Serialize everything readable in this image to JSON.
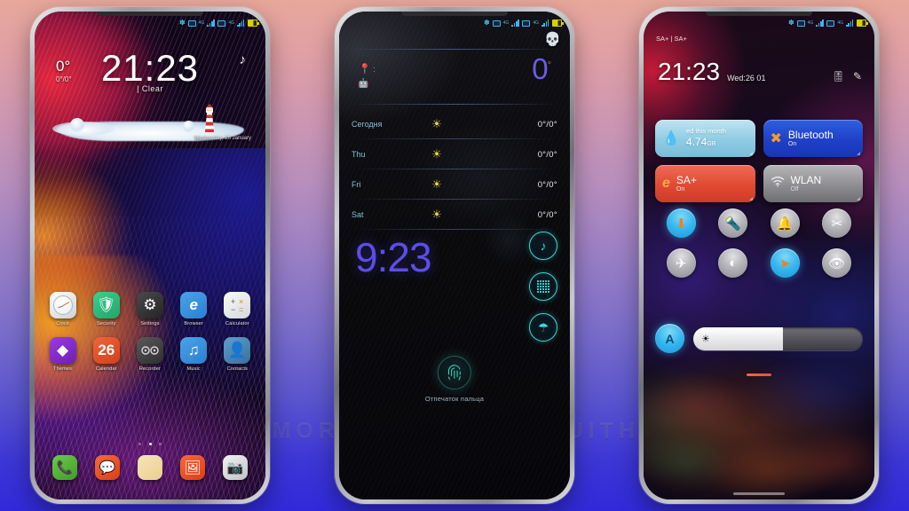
{
  "watermark": {
    "text": "VISIT FOR MORE THEMES - MIUITHEMER.COM"
  },
  "background": {
    "top_color": "#e8a79b",
    "mid_color": "#9a7fc4",
    "bottom_color": "#3129d9"
  },
  "phone1": {
    "name": "Lock screen / Home screen",
    "statusbar": {
      "bluetooth": "bluetooth-icon",
      "sim1": "sim-icon",
      "net1": "4G",
      "sim2": "sim-icon",
      "net2": "4G",
      "battery": "battery-icon"
    },
    "weather_corner": {
      "temp": "0°",
      "range": "0°/0°"
    },
    "clock": "21:23",
    "condition": "| Clear",
    "music_icon": "music-note-icon",
    "date": "Wednesday, 26 January",
    "apps_row1": [
      {
        "label": "Clock",
        "icon": "clock-icon"
      },
      {
        "label": "Security",
        "icon": "shield-icon"
      },
      {
        "label": "Settings",
        "icon": "gear-icon"
      },
      {
        "label": "Browser",
        "icon": "browser-e-icon"
      },
      {
        "label": "Calculator",
        "icon": "calculator-icon"
      }
    ],
    "apps_row2": [
      {
        "label": "Themes",
        "icon": "themes-diamond-icon"
      },
      {
        "label": "Calendar",
        "icon": "26"
      },
      {
        "label": "Recorder",
        "icon": "recorder-icon"
      },
      {
        "label": "Music",
        "icon": "music-icon"
      },
      {
        "label": "Contacts",
        "icon": "contacts-icon"
      }
    ],
    "dock": [
      {
        "label": "Phone",
        "icon": "phone-icon"
      },
      {
        "label": "Messages",
        "icon": "message-icon"
      },
      {
        "label": "Notes",
        "icon": "notes-icon"
      },
      {
        "label": "Gallery",
        "icon": "gallery-icon"
      },
      {
        "label": "Camera",
        "icon": "camera-icon"
      }
    ],
    "page_dots": 3,
    "active_dot": 1
  },
  "phone2": {
    "name": "Weather lock screen",
    "skull_icon": "skull-icon",
    "location_label": ":",
    "location_pin": "location-pin-icon",
    "android_icon": "android-icon",
    "big_temp": "0",
    "big_temp_unit": "°",
    "forecast": [
      {
        "day": "Сегодня",
        "icon": "sun-icon",
        "temps": "0°/0°"
      },
      {
        "day": "Thu",
        "icon": "sun-icon",
        "temps": "0°/0°"
      },
      {
        "day": "Fri",
        "icon": "sun-icon",
        "temps": "0°/0°"
      },
      {
        "day": "Sat",
        "icon": "sun-icon",
        "temps": "0°/0°"
      }
    ],
    "clock": "9:23",
    "side_buttons": [
      {
        "icon": "music-note-icon",
        "name": "music"
      },
      {
        "icon": "app-grid-icon",
        "name": "apps"
      },
      {
        "icon": "umbrella-icon",
        "name": "weather"
      }
    ],
    "fingerprint_icon": "fingerprint-icon",
    "fingerprint_label": "Отпечаток пальца"
  },
  "phone3": {
    "name": "Notification shade / Quick settings",
    "carrier": "SA+ | SA+",
    "clock": "21:23",
    "date": "Wed:26 01",
    "header_icons": [
      {
        "icon": "settings-slider-icon"
      },
      {
        "icon": "edit-pencil-icon"
      }
    ],
    "tiles": [
      {
        "title": "ed this month",
        "value": "4.74",
        "unit": "GB",
        "icon": "data-drop-icon",
        "state": "",
        "color": "#8fcbe4"
      },
      {
        "title": "Bluetooth",
        "sub": "On",
        "icon": "bluetooth-icon",
        "color": "#1e40c8"
      },
      {
        "title": "SA+",
        "sub": "On",
        "icon": "browser-e-icon",
        "color": "#e04a33"
      },
      {
        "title": "WLAN",
        "sub": "Off",
        "icon": "wifi-icon",
        "color": "#8e8e92"
      }
    ],
    "round_toggles": [
      {
        "icon": "location-icon",
        "on": true
      },
      {
        "icon": "flashlight-icon",
        "on": false
      },
      {
        "icon": "bell-icon",
        "on": false
      },
      {
        "icon": "screenshot-scissors-icon",
        "on": false
      },
      {
        "icon": "airplane-icon",
        "on": false
      },
      {
        "icon": "contrast-icon",
        "on": false
      },
      {
        "icon": "navigation-arrow-icon",
        "on": true
      },
      {
        "icon": "eye-icon",
        "on": false
      }
    ],
    "auto_brightness_label": "A",
    "brightness_percent": 53,
    "brightness_icon": "brightness-sun-icon"
  }
}
